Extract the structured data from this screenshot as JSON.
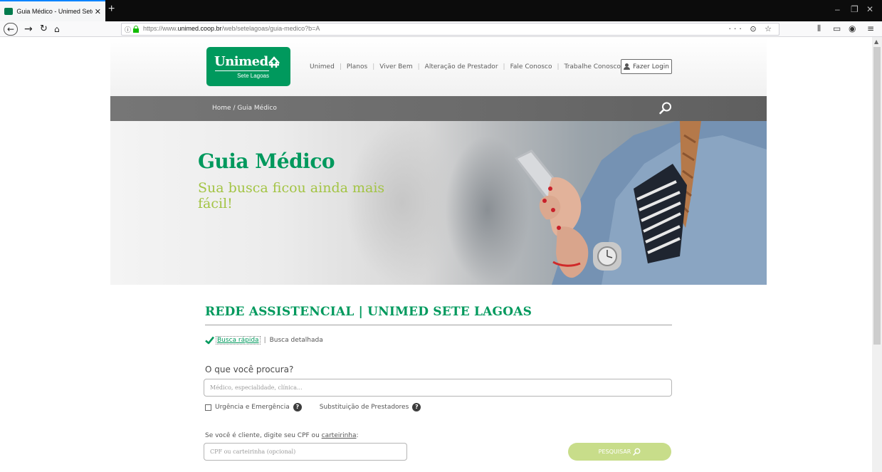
{
  "browser": {
    "tab_title": "Guia Médico - Unimed Sete La",
    "new_tab": "+",
    "url_prefix": "https://www.",
    "url_domain": "unimed.coop.br",
    "url_path": "/web/setelagoas/guia-medico?b=A",
    "url_actions": "··· ⊙ ☆",
    "window_controls": [
      "–",
      "❐",
      "✕"
    ]
  },
  "header": {
    "logo_brand": "Unimed",
    "logo_sub": "Sete Lagoas",
    "nav": [
      "Unimed",
      "Planos",
      "Viver Bem",
      "Alteração de Prestador",
      "Fale Conosco",
      "Trabalhe Conosco"
    ],
    "login_label": "Fazer Login"
  },
  "breadcrumb": "Home / Guia Médico",
  "hero": {
    "title": "Guia Médico",
    "subtitle": "Sua busca ficou ainda mais fácil!"
  },
  "section": {
    "title": "REDE ASSISTENCIAL | UNIMED SETE LAGOAS",
    "mode_quick": "Busca rápida",
    "mode_sep": "|",
    "mode_detailed": "Busca detalhada"
  },
  "search": {
    "label": "O que você procura?",
    "placeholder": "Médico, especialidade, clínica...",
    "opt_urgency": "Urgência e Emergência",
    "opt_substitution": "Substituição de Prestadores",
    "cpf_label_prefix": "Se você é cliente, digite seu CPF ou ",
    "cpf_label_link": "carteirinha",
    "cpf_label_suffix": ":",
    "cpf_placeholder": "CPF ou carteirinha (opcional)",
    "button": "PESQUISAR"
  },
  "colors": {
    "brand_green": "#00995d",
    "lime": "#a3c444",
    "button_bg": "#c8dd8a"
  }
}
